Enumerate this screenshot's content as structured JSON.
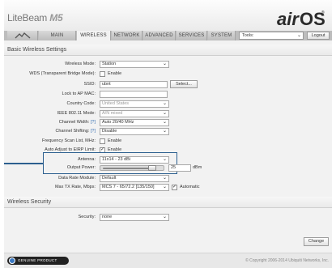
{
  "header": {
    "product_prefix": "LiteBeam",
    "product_model": "M5",
    "logo_text_air": "air",
    "logo_text_os": "OS",
    "logo_trademark": "®"
  },
  "tabs": [
    {
      "label": "",
      "icon": "airmax-icon"
    },
    {
      "label": "MAIN"
    },
    {
      "label": "WIRELESS",
      "active": true
    },
    {
      "label": "NETWORK"
    },
    {
      "label": "ADVANCED"
    },
    {
      "label": "SERVICES"
    },
    {
      "label": "SYSTEM"
    }
  ],
  "tools": {
    "value": "Tools:",
    "logout_label": "Logout"
  },
  "basic": {
    "title": "Basic Wireless Settings",
    "wireless_mode": {
      "label": "Wireless Mode:",
      "value": "Station"
    },
    "wds": {
      "label": "WDS (Transparent Bridge Mode):",
      "checked": false,
      "text": "Enable"
    },
    "ssid": {
      "label": "SSID:",
      "value": "ubnt",
      "select_label": "Select..."
    },
    "lock_ap": {
      "label": "Lock to AP MAC:",
      "value": ""
    },
    "country": {
      "label": "Country Code:",
      "value": "United States"
    },
    "ieee": {
      "label": "IEEE 802.11 Mode:",
      "value": "A/N mixed"
    },
    "channel_width": {
      "label": "Channel Width:",
      "help": "[?]",
      "value": "Auto 20/40 MHz"
    },
    "channel_shifting": {
      "label": "Channel Shifting:",
      "help": "[?]",
      "value": "Disable"
    },
    "freq_scan": {
      "label": "Frequency Scan List, MHz:",
      "checked": false,
      "text": "Enable"
    },
    "erp": {
      "label": "Auto Adjust to EIRP Limit:",
      "checked": true,
      "text": "Enable"
    },
    "antenna": {
      "label": "Antenna:",
      "value": "11x14 - 23 dBi"
    },
    "output_power": {
      "label": "Output Power:",
      "value": "25",
      "unit": "dBm",
      "fraction": 0.92
    },
    "data_rate": {
      "label": "Data Rate Module:",
      "value": "Default"
    },
    "max_tx": {
      "label": "Max TX Rate, Mbps:",
      "value": "MCS 7 - 65/72.2 [135/150]",
      "auto_checked": true,
      "auto_text": "Automatic"
    }
  },
  "security": {
    "title": "Wireless Security",
    "label": "Security:",
    "value": "none"
  },
  "change_label": "Change",
  "footer": {
    "badge_text": "GENUINE PRODUCT",
    "copyright": "© Copyright 2006-2014 Ubiquiti Networks, Inc."
  },
  "colors": {
    "highlight": "#2c5f8f",
    "accent_blue": "#3a78c2"
  }
}
